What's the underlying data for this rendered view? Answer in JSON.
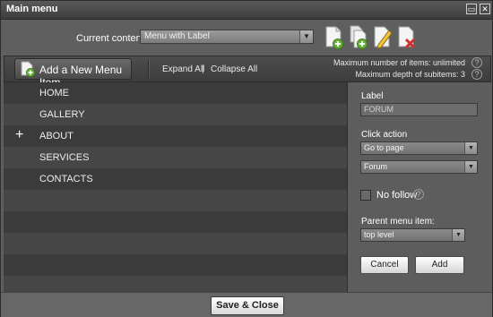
{
  "window": {
    "title": "Main menu",
    "restore_icon": "restore-icon",
    "close_icon": "close-icon"
  },
  "content_selector": {
    "label": "Current content:",
    "selected": "Menu with Label",
    "toolbar_icons": [
      "add-document-icon",
      "copy-document-icon",
      "edit-document-icon",
      "delete-document-icon"
    ]
  },
  "toolbar": {
    "add_item_label": "Add a New Menu Item",
    "expand_all": "Expand All",
    "separator": "|",
    "collapse_all": "Collapse All",
    "max_items": "Maximum number of items: unlimited",
    "max_depth": "Maximum depth of subitems: 3"
  },
  "menu_items": [
    {
      "label": "HOME",
      "expandable": false
    },
    {
      "label": "GALLERY",
      "expandable": false
    },
    {
      "label": "ABOUT",
      "expandable": true
    },
    {
      "label": "SERVICES",
      "expandable": false
    },
    {
      "label": "CONTACTS",
      "expandable": false
    }
  ],
  "expand_symbol": "+",
  "editor": {
    "label_title": "Label",
    "label_value": "FORUM",
    "click_action_title": "Click action",
    "click_action_value": "Go to page",
    "page_value": "Forum",
    "no_follow_label": "No follow",
    "no_follow_checked": false,
    "parent_title": "Parent menu item:",
    "parent_value": "top level",
    "cancel_label": "Cancel",
    "add_label": "Add"
  },
  "footer": {
    "save_close_label": "Save & Close"
  },
  "colors": {
    "panel": "#5e5e5e",
    "list_dark": "#3b3b3b",
    "list_light": "#464646",
    "accent_green": "#6ab03c",
    "accent_red": "#d0302a"
  }
}
